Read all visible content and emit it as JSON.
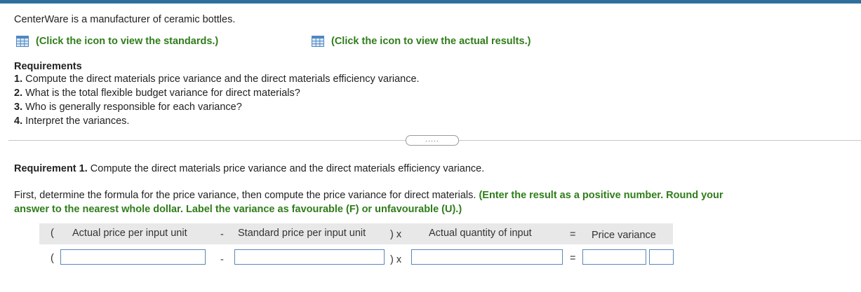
{
  "intro": "CenterWare is a manufacturer of ceramic bottles.",
  "links": {
    "standards": "(Click the icon to view the standards.)",
    "actual": "(Click the icon to view the actual results.)",
    "icon": "table-grid-icon"
  },
  "requirements": {
    "title": "Requirements",
    "items": [
      {
        "num": "1.",
        "text": " Compute the direct materials price variance and the direct materials efficiency variance."
      },
      {
        "num": "2.",
        "text": " What is the total flexible budget variance for direct materials?"
      },
      {
        "num": "3.",
        "text": " Who is generally responsible for each variance?"
      },
      {
        "num": "4.",
        "text": " Interpret the variances."
      }
    ]
  },
  "divider_handle": "·····",
  "req1": {
    "label": "Requirement 1.",
    "text": " Compute the direct materials price variance and the direct materials efficiency variance."
  },
  "instructions": {
    "plain": "First, determine the formula for the price variance, then compute the price variance for direct materials. ",
    "green_line1": "(Enter the result as a positive number. Round your",
    "green_line2": "answer to the nearest whole dollar. Label the variance as favourable (F) or unfavourable (U).)"
  },
  "formula": {
    "open_paren": "(",
    "actual_price": "Actual price per input unit",
    "minus": "-",
    "standard_price": "Standard price per input unit",
    "close_times": ") x",
    "actual_qty": "Actual quantity of input",
    "equals": "=",
    "price_variance": "Price variance"
  },
  "inputs": {
    "actual_price": "",
    "standard_price": "",
    "actual_qty": "",
    "variance_amount": "",
    "variance_label": ""
  },
  "colors": {
    "accent_green": "#2f7d1a",
    "top_bar": "#2e6f9e",
    "input_border": "#5a86b8",
    "formula_bg": "#e8e8e8"
  }
}
